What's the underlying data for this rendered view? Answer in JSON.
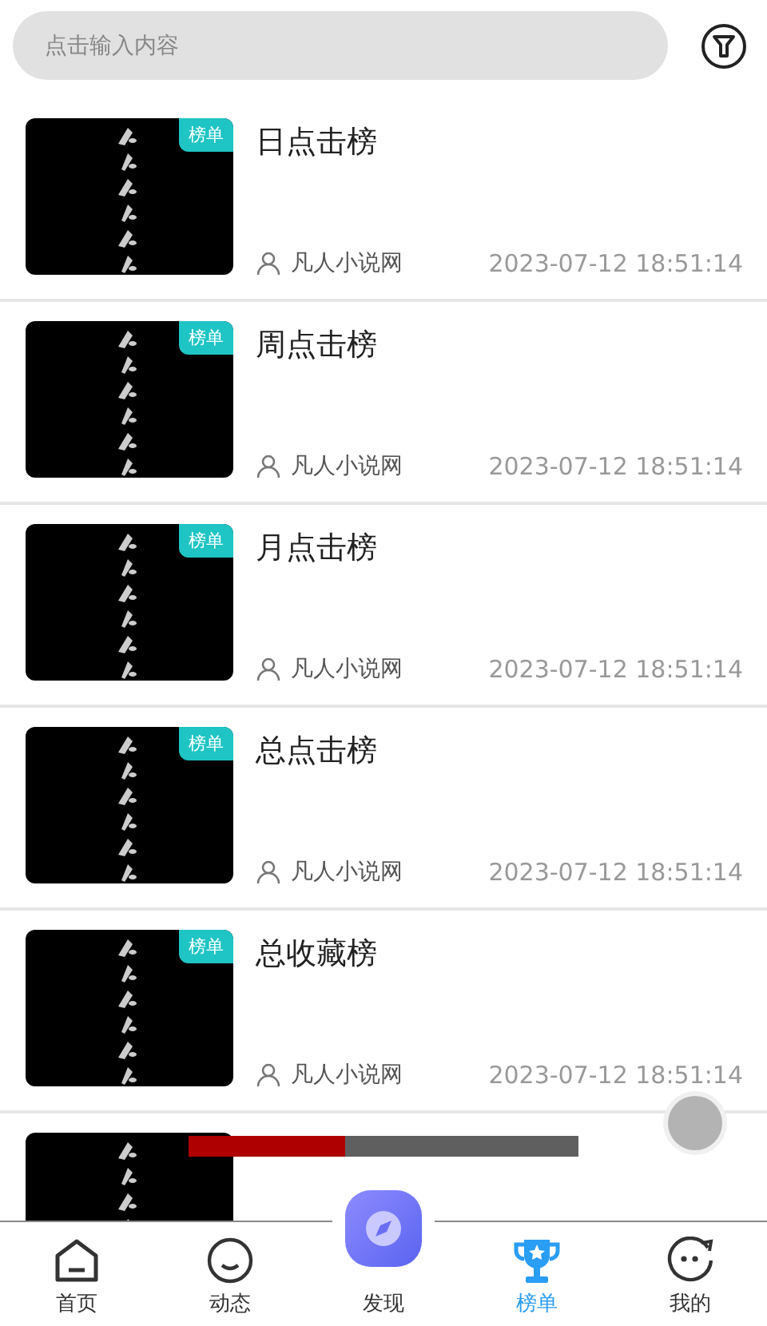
{
  "search": {
    "placeholder": "点击输入内容"
  },
  "items": [
    {
      "badge": "榜单",
      "title": "日点击榜",
      "author": "凡人小说网",
      "time": "2023-07-12 18:51:14"
    },
    {
      "badge": "榜单",
      "title": "周点击榜",
      "author": "凡人小说网",
      "time": "2023-07-12 18:51:14"
    },
    {
      "badge": "榜单",
      "title": "月点击榜",
      "author": "凡人小说网",
      "time": "2023-07-12 18:51:14"
    },
    {
      "badge": "榜单",
      "title": "总点击榜",
      "author": "凡人小说网",
      "time": "2023-07-12 18:51:14"
    },
    {
      "badge": "榜单",
      "title": "总收藏榜",
      "author": "凡人小说网",
      "time": "2023-07-12 18:51:14"
    }
  ],
  "loading_bar": {
    "level": 0.4
  },
  "tabs": [
    {
      "kind": "home",
      "label": "首页",
      "selected": false
    },
    {
      "kind": "feed",
      "label": "动态",
      "selected": false
    },
    {
      "kind": "discover",
      "label": "发现",
      "selected": false
    },
    {
      "kind": "rank",
      "label": "榜单",
      "selected": true
    },
    {
      "kind": "me",
      "label": "我的",
      "selected": false
    }
  ]
}
